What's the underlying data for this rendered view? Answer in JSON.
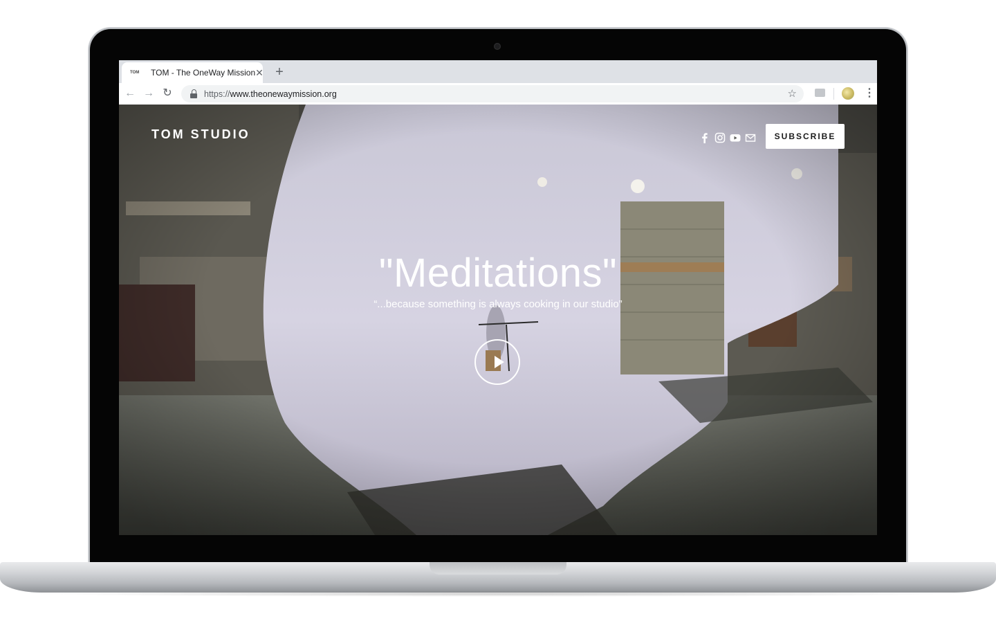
{
  "browser": {
    "tab": {
      "favicon": "TOM",
      "title": "TOM - The OneWay Mission",
      "close_icon": "close-icon"
    },
    "new_tab_label": "+",
    "nav": {
      "back_icon": "arrow-left-icon",
      "forward_icon": "arrow-right-icon",
      "reload_icon": "reload-icon"
    },
    "url_scheme": "https://",
    "url_host": "www.theonewaymission.org",
    "bookmark_icon": "star-icon",
    "menu_icon": "more-vertical-icon"
  },
  "site": {
    "logo": "TOM STUDIO",
    "social_icons": [
      "facebook-icon",
      "instagram-icon",
      "youtube-icon",
      "mail-icon"
    ],
    "subscribe_label": "SUBSCRIBE",
    "hero_title": "\"Meditations\"",
    "hero_subtitle": "“...because something is always cooking in our studio”",
    "play_icon": "play-icon"
  }
}
